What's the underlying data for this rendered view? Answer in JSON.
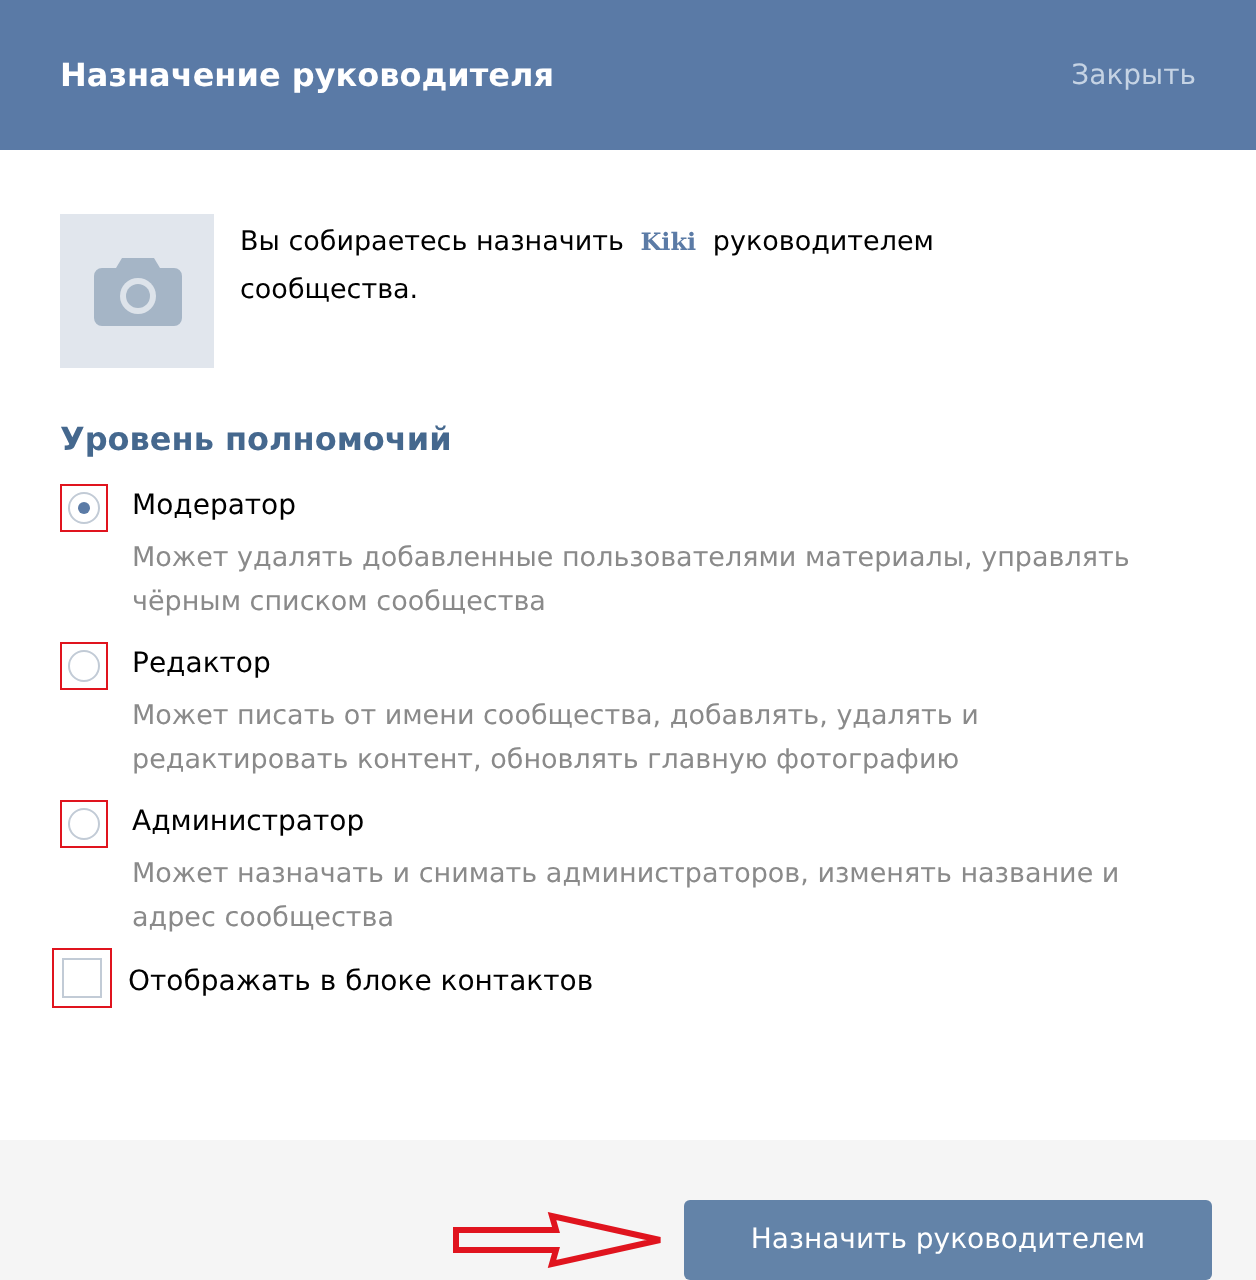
{
  "window": {
    "title": "Назначение руководителя",
    "close_label": "Закрыть"
  },
  "intro": {
    "before": "Вы собираетесь назначить",
    "name": "Kiki",
    "after": "руководителем сообщества."
  },
  "section_title": "Уровень полномочий",
  "roles": [
    {
      "label": "Модератор",
      "description": "Может удалять добавленные пользователями материалы, управлять чёрным списком сообщества",
      "selected": true
    },
    {
      "label": "Редактор",
      "description": "Может писать от имени сообщества, добавлять, удалять и редактировать контент, обновлять главную фотографию",
      "selected": false
    },
    {
      "label": "Администратор",
      "description": "Может назначать и снимать администраторов, изменять название и адрес сообщества",
      "selected": false
    }
  ],
  "show_in_contacts": {
    "label": "Отображать в блоке контактов",
    "checked": false
  },
  "submit_label": "Назначить руководителем"
}
